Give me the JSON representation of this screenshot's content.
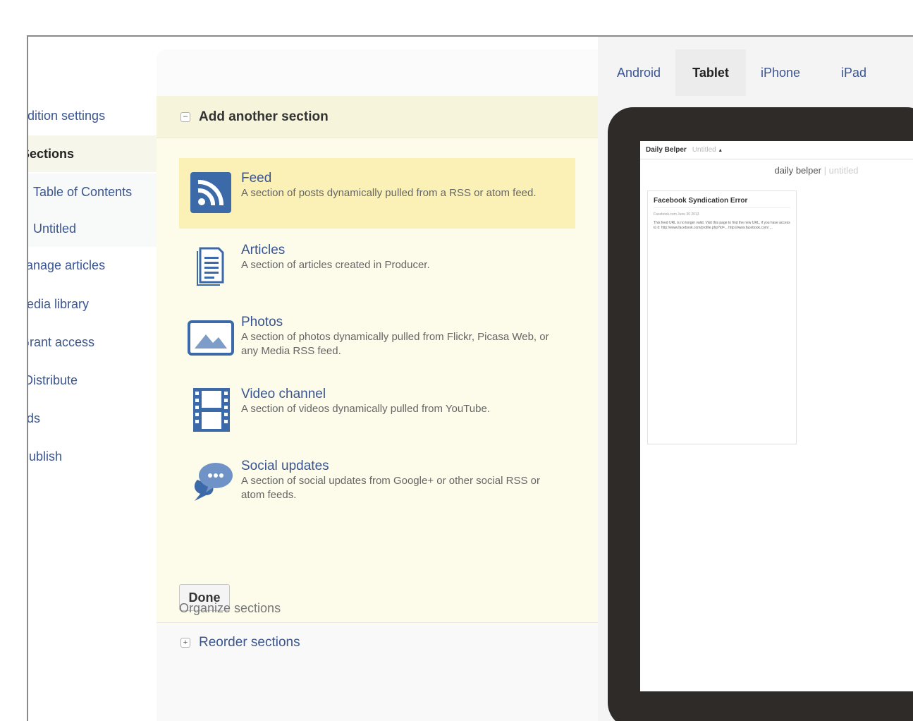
{
  "sidebar": {
    "items": [
      {
        "label": "Edition settings"
      },
      {
        "label": "Sections"
      },
      {
        "label": "Table of Contents"
      },
      {
        "label": "Untitled"
      },
      {
        "label": "Manage articles"
      },
      {
        "label": "Media library"
      },
      {
        "label": "Grant access"
      },
      {
        "label": "Distribute"
      },
      {
        "label": "Ads"
      },
      {
        "label": "Publish"
      }
    ]
  },
  "add_section": {
    "title": "Add another section",
    "collapse_glyph": "–",
    "options": [
      {
        "title": "Feed",
        "desc": "A section of posts dynamically pulled from a RSS or atom feed.",
        "icon": "rss-icon"
      },
      {
        "title": "Articles",
        "desc": "A section of articles created in Producer.",
        "icon": "document-icon"
      },
      {
        "title": "Photos",
        "desc": "A section of photos dynamically pulled from Flickr, Picasa Web, or any Media RSS feed.",
        "icon": "photo-icon"
      },
      {
        "title": "Video channel",
        "desc": "A section of videos dynamically pulled from YouTube.",
        "icon": "film-icon"
      },
      {
        "title": "Social updates",
        "desc": "A section of social updates from Google+ or other social RSS or atom feeds.",
        "icon": "speech-bubbles-icon"
      }
    ],
    "done_label": "Done"
  },
  "organize": {
    "title": "Organize sections",
    "reorder_label": "Reorder sections",
    "expand_glyph": "+"
  },
  "preview": {
    "tabs": [
      "Android",
      "Tablet",
      "iPhone",
      "iPad"
    ],
    "active_tab": "Tablet",
    "screen": {
      "publication": "Daily Belper",
      "edition": "Untitled",
      "caret": "▴",
      "title_main": "daily belper",
      "title_sep": "|",
      "title_sub": "untitled",
      "card_title": "Facebook Syndication Error",
      "card_meta": "Facebook.com June 30 2013",
      "card_body": "This feed URL is no longer valid. Visit this page to find the new URL, if you have access to it: http://www.facebook.com/profile.php?id=... http://www.facebook.com/ ..."
    }
  },
  "colors": {
    "link": "#3a5590",
    "highlight": "#fbf1b6",
    "panel_bg": "#fdfbea",
    "icon_blue": "#3c6aa8",
    "tablet_bezel": "#2f2b29"
  }
}
